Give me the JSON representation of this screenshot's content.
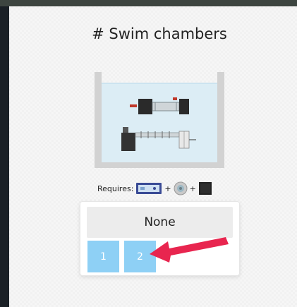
{
  "section": {
    "title": "# Swim chambers"
  },
  "requires": {
    "label": "Requires:",
    "plus": "+",
    "items": [
      "controller-device",
      "pump-device",
      "sensor-device"
    ]
  },
  "selector": {
    "none_label": "None",
    "options": [
      "1",
      "2"
    ],
    "highlighted": "2"
  },
  "annotation": {
    "arrow_color": "#e8254f",
    "accent_color": "#8ed0f5"
  },
  "icons": [
    "swim-chamber-image",
    "controller-icon",
    "pump-icon",
    "sensor-icon",
    "red-arrow-icon"
  ]
}
